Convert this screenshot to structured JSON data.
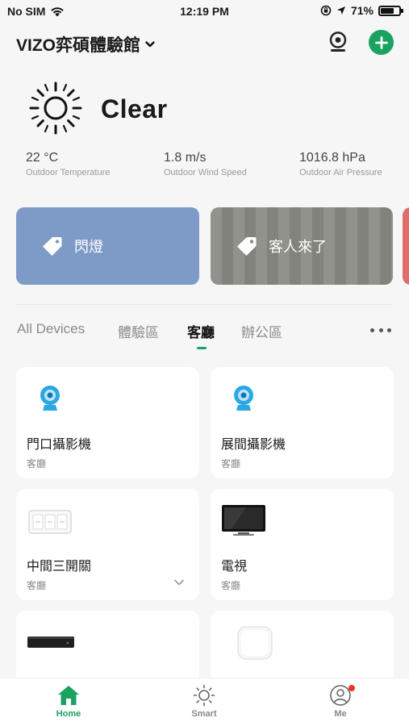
{
  "status_bar": {
    "carrier": "No SIM",
    "time": "12:19 PM",
    "battery": "71%",
    "battery_level": 0.71
  },
  "header": {
    "home_name": "VIZO弈碩體驗館"
  },
  "weather": {
    "condition": "Clear",
    "stats": [
      {
        "value": "22 °C",
        "label": "Outdoor Temperature"
      },
      {
        "value": "1.8 m/s",
        "label": "Outdoor Wind Speed"
      },
      {
        "value": "1016.8 hPa",
        "label": "Outdoor Air Pressure"
      }
    ]
  },
  "scenes": [
    {
      "label": "閃燈",
      "color": "#7e9bc7"
    },
    {
      "label": "客人來了",
      "color": "#8a8b85"
    }
  ],
  "tabs": [
    {
      "label": "All Devices",
      "active": false
    },
    {
      "label": "體驗區",
      "active": false
    },
    {
      "label": "客廳",
      "active": true
    },
    {
      "label": "辦公區",
      "active": false
    }
  ],
  "devices": [
    {
      "name": "門口攝影機",
      "room": "客廳",
      "icon": "camera-icon"
    },
    {
      "name": "展間攝影機",
      "room": "客廳",
      "icon": "camera-icon"
    },
    {
      "name": "中間三開關",
      "room": "客廳",
      "icon": "switch-icon"
    },
    {
      "name": "電視",
      "room": "客廳",
      "icon": "tv-icon"
    },
    {
      "name": "",
      "room": "",
      "icon": "set-top-box-icon"
    },
    {
      "name": "",
      "room": "",
      "icon": "hub-icon"
    }
  ],
  "bottom_nav": [
    {
      "label": "Home",
      "active": true
    },
    {
      "label": "Smart",
      "active": false
    },
    {
      "label": "Me",
      "active": false
    }
  ],
  "colors": {
    "accent": "#1aa260",
    "background": "#f6f6f6",
    "notification": "#e33333"
  }
}
